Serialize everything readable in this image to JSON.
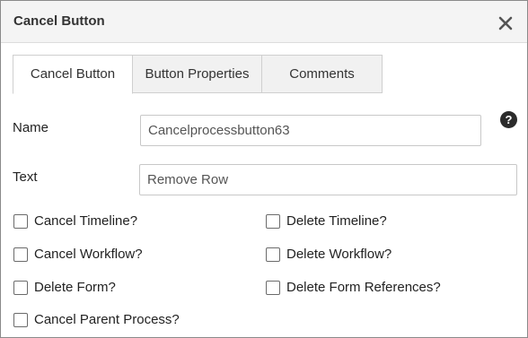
{
  "dialog": {
    "title": "Cancel Button",
    "close_icon": "close-icon"
  },
  "tabs": [
    {
      "label": "Cancel Button",
      "active": true
    },
    {
      "label": "Button Properties",
      "active": false
    },
    {
      "label": "Comments",
      "active": false
    }
  ],
  "form": {
    "name_label": "Name",
    "name_value": "Cancelprocessbutton63",
    "text_label": "Text",
    "text_value": "Remove Row",
    "help_icon": "help-icon",
    "help_glyph": "?"
  },
  "checkboxes": [
    {
      "label": "Cancel Timeline?",
      "checked": false
    },
    {
      "label": "Delete Timeline?",
      "checked": false
    },
    {
      "label": "Cancel Workflow?",
      "checked": false
    },
    {
      "label": "Delete Workflow?",
      "checked": false
    },
    {
      "label": "Delete Form?",
      "checked": false
    },
    {
      "label": "Delete Form References?",
      "checked": false
    },
    {
      "label": "Cancel Parent Process?",
      "checked": false
    }
  ],
  "colors": {
    "titlebar": "#f4f4f4",
    "border": "#8a8a8a",
    "tab_inactive": "#f1f1f1"
  }
}
